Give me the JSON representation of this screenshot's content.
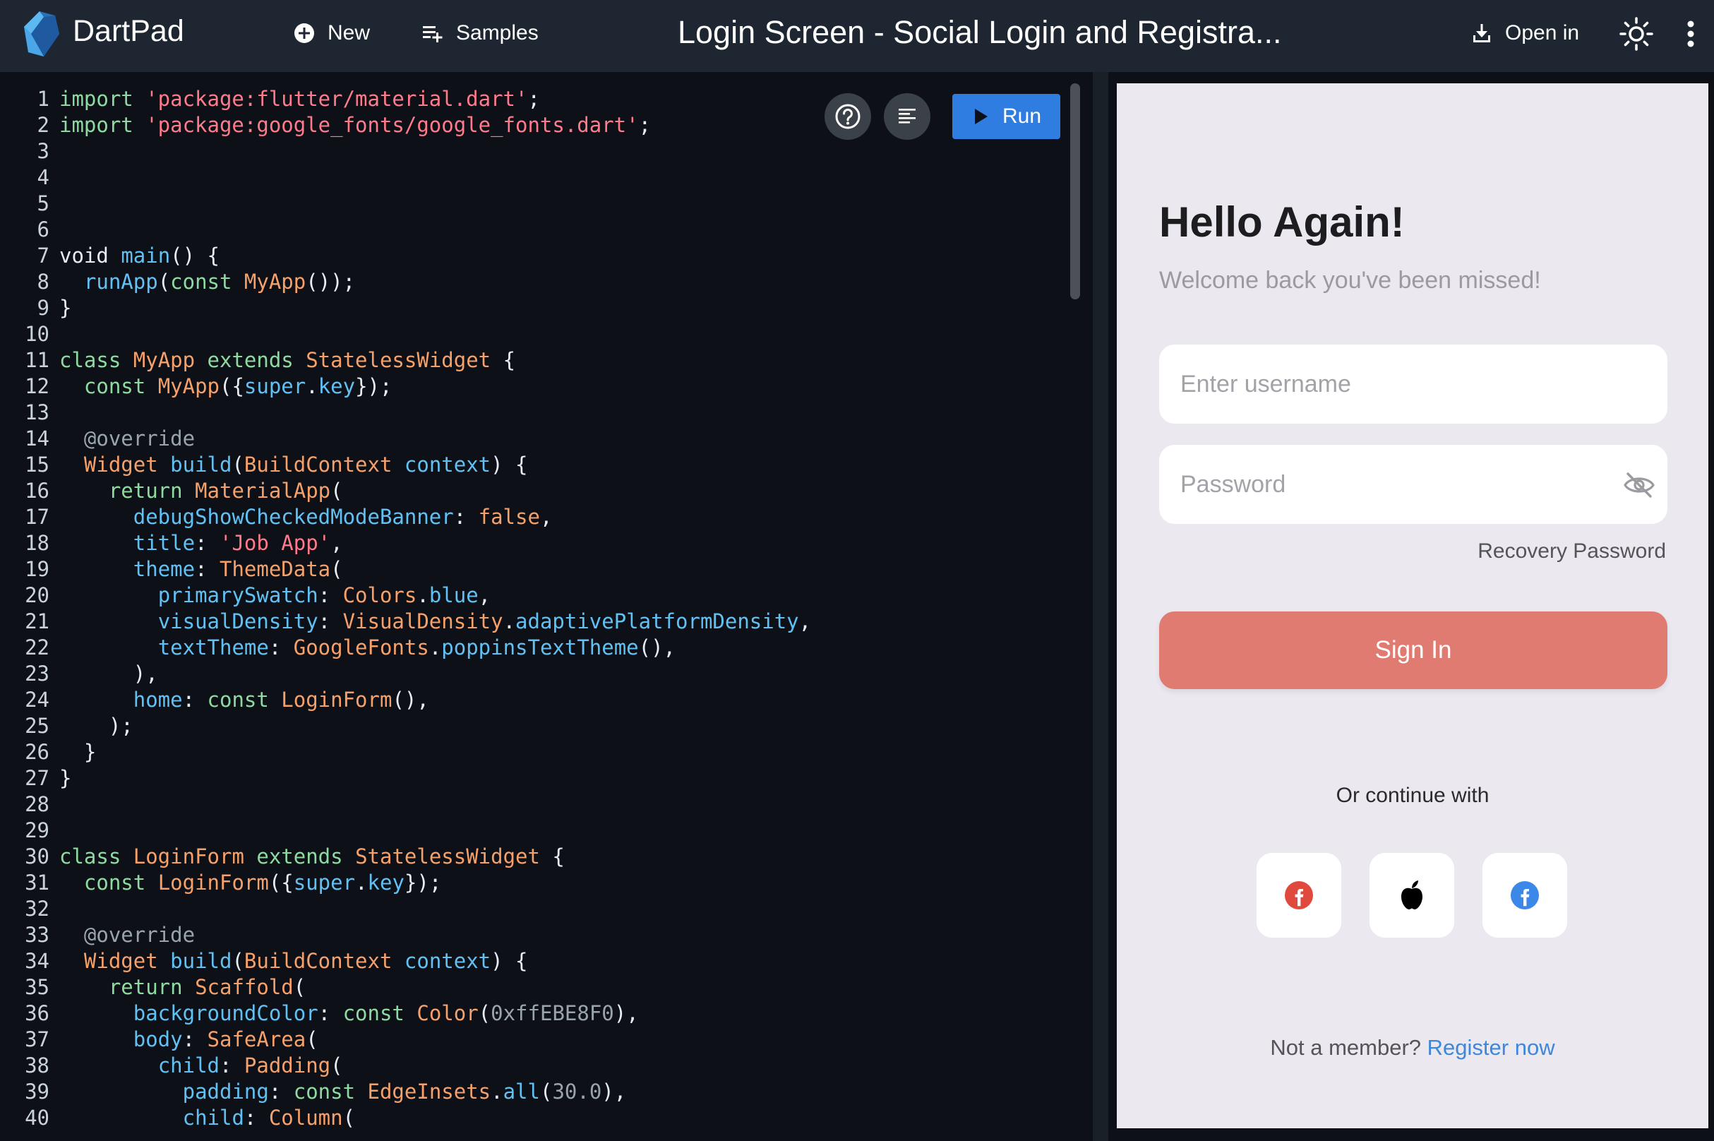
{
  "header": {
    "app_name": "DartPad",
    "new_label": "New",
    "samples_label": "Samples",
    "title": "Login Screen - Social Login and Registra...",
    "open_in_label": "Open in",
    "icons": [
      "dart-logo-icon",
      "add-circle-icon",
      "playlist-add-icon",
      "download-icon",
      "sun-icon",
      "more-vert-icon"
    ]
  },
  "editor": {
    "run_label": "Run",
    "icons": [
      "help-icon",
      "format-icon",
      "play-icon"
    ],
    "code_lines": [
      [
        [
          "kw",
          "import "
        ],
        [
          "str",
          "'package:flutter/material.dart'"
        ],
        [
          "txt",
          ";"
        ]
      ],
      [
        [
          "kw",
          "import "
        ],
        [
          "str",
          "'package:google_fonts/google_fonts.dart'"
        ],
        [
          "txt",
          ";"
        ]
      ],
      [],
      [],
      [],
      [],
      [
        [
          "txt",
          "void "
        ],
        [
          "fn",
          "main"
        ],
        [
          "txt",
          "() {"
        ]
      ],
      [
        [
          "txt",
          "  "
        ],
        [
          "fn",
          "runApp"
        ],
        [
          "txt",
          "("
        ],
        [
          "kw",
          "const "
        ],
        [
          "type",
          "MyApp"
        ],
        [
          "txt",
          "());"
        ]
      ],
      [
        [
          "txt",
          "}"
        ]
      ],
      [],
      [
        [
          "kw",
          "class "
        ],
        [
          "type",
          "MyApp "
        ],
        [
          "kw",
          "extends "
        ],
        [
          "type",
          "StatelessWidget "
        ],
        [
          "txt",
          "{"
        ]
      ],
      [
        [
          "txt",
          "  "
        ],
        [
          "kw",
          "const "
        ],
        [
          "type",
          "MyApp"
        ],
        [
          "txt",
          "({"
        ],
        [
          "fn",
          "super"
        ],
        [
          "txt",
          "."
        ],
        [
          "fn",
          "key"
        ],
        [
          "txt",
          "});"
        ]
      ],
      [],
      [
        [
          "ann",
          "  @override"
        ]
      ],
      [
        [
          "txt",
          "  "
        ],
        [
          "type",
          "Widget "
        ],
        [
          "fn",
          "build"
        ],
        [
          "txt",
          "("
        ],
        [
          "type",
          "BuildContext "
        ],
        [
          "fn",
          "context"
        ],
        [
          "txt",
          ") {"
        ]
      ],
      [
        [
          "txt",
          "    "
        ],
        [
          "kw",
          "return "
        ],
        [
          "type",
          "MaterialApp"
        ],
        [
          "txt",
          "("
        ]
      ],
      [
        [
          "txt",
          "      "
        ],
        [
          "fn",
          "debugShowCheckedModeBanner"
        ],
        [
          "txt",
          ": "
        ],
        [
          "type",
          "false"
        ],
        [
          "txt",
          ","
        ]
      ],
      [
        [
          "txt",
          "      "
        ],
        [
          "fn",
          "title"
        ],
        [
          "txt",
          ": "
        ],
        [
          "str",
          "'Job App'"
        ],
        [
          "txt",
          ","
        ]
      ],
      [
        [
          "txt",
          "      "
        ],
        [
          "fn",
          "theme"
        ],
        [
          "txt",
          ": "
        ],
        [
          "type",
          "ThemeData"
        ],
        [
          "txt",
          "("
        ]
      ],
      [
        [
          "txt",
          "        "
        ],
        [
          "fn",
          "primarySwatch"
        ],
        [
          "txt",
          ": "
        ],
        [
          "type",
          "Colors"
        ],
        [
          "txt",
          "."
        ],
        [
          "fn",
          "blue"
        ],
        [
          "txt",
          ","
        ]
      ],
      [
        [
          "txt",
          "        "
        ],
        [
          "fn",
          "visualDensity"
        ],
        [
          "txt",
          ": "
        ],
        [
          "type",
          "VisualDensity"
        ],
        [
          "txt",
          "."
        ],
        [
          "fn",
          "adaptivePlatformDensity"
        ],
        [
          "txt",
          ","
        ]
      ],
      [
        [
          "txt",
          "        "
        ],
        [
          "fn",
          "textTheme"
        ],
        [
          "txt",
          ": "
        ],
        [
          "type",
          "GoogleFonts"
        ],
        [
          "txt",
          "."
        ],
        [
          "fn",
          "poppinsTextTheme"
        ],
        [
          "txt",
          "(),"
        ]
      ],
      [
        [
          "txt",
          "      ),"
        ]
      ],
      [
        [
          "txt",
          "      "
        ],
        [
          "fn",
          "home"
        ],
        [
          "txt",
          ": "
        ],
        [
          "kw",
          "const "
        ],
        [
          "type",
          "LoginForm"
        ],
        [
          "txt",
          "(),"
        ]
      ],
      [
        [
          "txt",
          "    );"
        ]
      ],
      [
        [
          "txt",
          "  }"
        ]
      ],
      [
        [
          "txt",
          "}"
        ]
      ],
      [],
      [],
      [
        [
          "kw",
          "class "
        ],
        [
          "type",
          "LoginForm "
        ],
        [
          "kw",
          "extends "
        ],
        [
          "type",
          "StatelessWidget "
        ],
        [
          "txt",
          "{"
        ]
      ],
      [
        [
          "txt",
          "  "
        ],
        [
          "kw",
          "const "
        ],
        [
          "type",
          "LoginForm"
        ],
        [
          "txt",
          "({"
        ],
        [
          "fn",
          "super"
        ],
        [
          "txt",
          "."
        ],
        [
          "fn",
          "key"
        ],
        [
          "txt",
          "});"
        ]
      ],
      [],
      [
        [
          "ann",
          "  @override"
        ]
      ],
      [
        [
          "txt",
          "  "
        ],
        [
          "type",
          "Widget "
        ],
        [
          "fn",
          "build"
        ],
        [
          "txt",
          "("
        ],
        [
          "type",
          "BuildContext "
        ],
        [
          "fn",
          "context"
        ],
        [
          "txt",
          ") {"
        ]
      ],
      [
        [
          "txt",
          "    "
        ],
        [
          "kw",
          "return "
        ],
        [
          "type",
          "Scaffold"
        ],
        [
          "txt",
          "("
        ]
      ],
      [
        [
          "txt",
          "      "
        ],
        [
          "fn",
          "backgroundColor"
        ],
        [
          "txt",
          ": "
        ],
        [
          "kw",
          "const "
        ],
        [
          "type",
          "Color"
        ],
        [
          "txt",
          "("
        ],
        [
          "num",
          "0xffEBE8F0"
        ],
        [
          "txt",
          "),"
        ]
      ],
      [
        [
          "txt",
          "      "
        ],
        [
          "fn",
          "body"
        ],
        [
          "txt",
          ": "
        ],
        [
          "type",
          "SafeArea"
        ],
        [
          "txt",
          "("
        ]
      ],
      [
        [
          "txt",
          "        "
        ],
        [
          "fn",
          "child"
        ],
        [
          "txt",
          ": "
        ],
        [
          "type",
          "Padding"
        ],
        [
          "txt",
          "("
        ]
      ],
      [
        [
          "txt",
          "          "
        ],
        [
          "fn",
          "padding"
        ],
        [
          "txt",
          ": "
        ],
        [
          "kw",
          "const "
        ],
        [
          "type",
          "EdgeInsets"
        ],
        [
          "txt",
          "."
        ],
        [
          "fn",
          "all"
        ],
        [
          "txt",
          "("
        ],
        [
          "num",
          "30.0"
        ],
        [
          "txt",
          "),"
        ]
      ],
      [
        [
          "txt",
          "          "
        ],
        [
          "fn",
          "child"
        ],
        [
          "txt",
          ": "
        ],
        [
          "type",
          "Column"
        ],
        [
          "txt",
          "("
        ]
      ]
    ]
  },
  "preview": {
    "heading": "Hello Again!",
    "subheading": "Welcome back you've been missed!",
    "username_placeholder": "Enter username",
    "password_placeholder": "Password",
    "recovery_label": "Recovery Password",
    "signin_label": "Sign In",
    "continue_label": "Or continue with",
    "member_text": "Not a member? ",
    "register_label": "Register now",
    "social_icons": [
      "google-icon",
      "apple-icon",
      "facebook-icon"
    ],
    "colors": {
      "background": "#ebe8f0",
      "signin": "#e07b72",
      "link": "#3f87d8"
    }
  },
  "colors": {
    "topbar": "#1e2731",
    "editor_bg": "#0d1117",
    "run_button": "#2f7de1",
    "syntax": {
      "keyword": "#8ddba0",
      "string": "#ff7b8c",
      "type": "#f6a06a",
      "function": "#61c1f5",
      "annotation": "#9aa4ad"
    }
  }
}
